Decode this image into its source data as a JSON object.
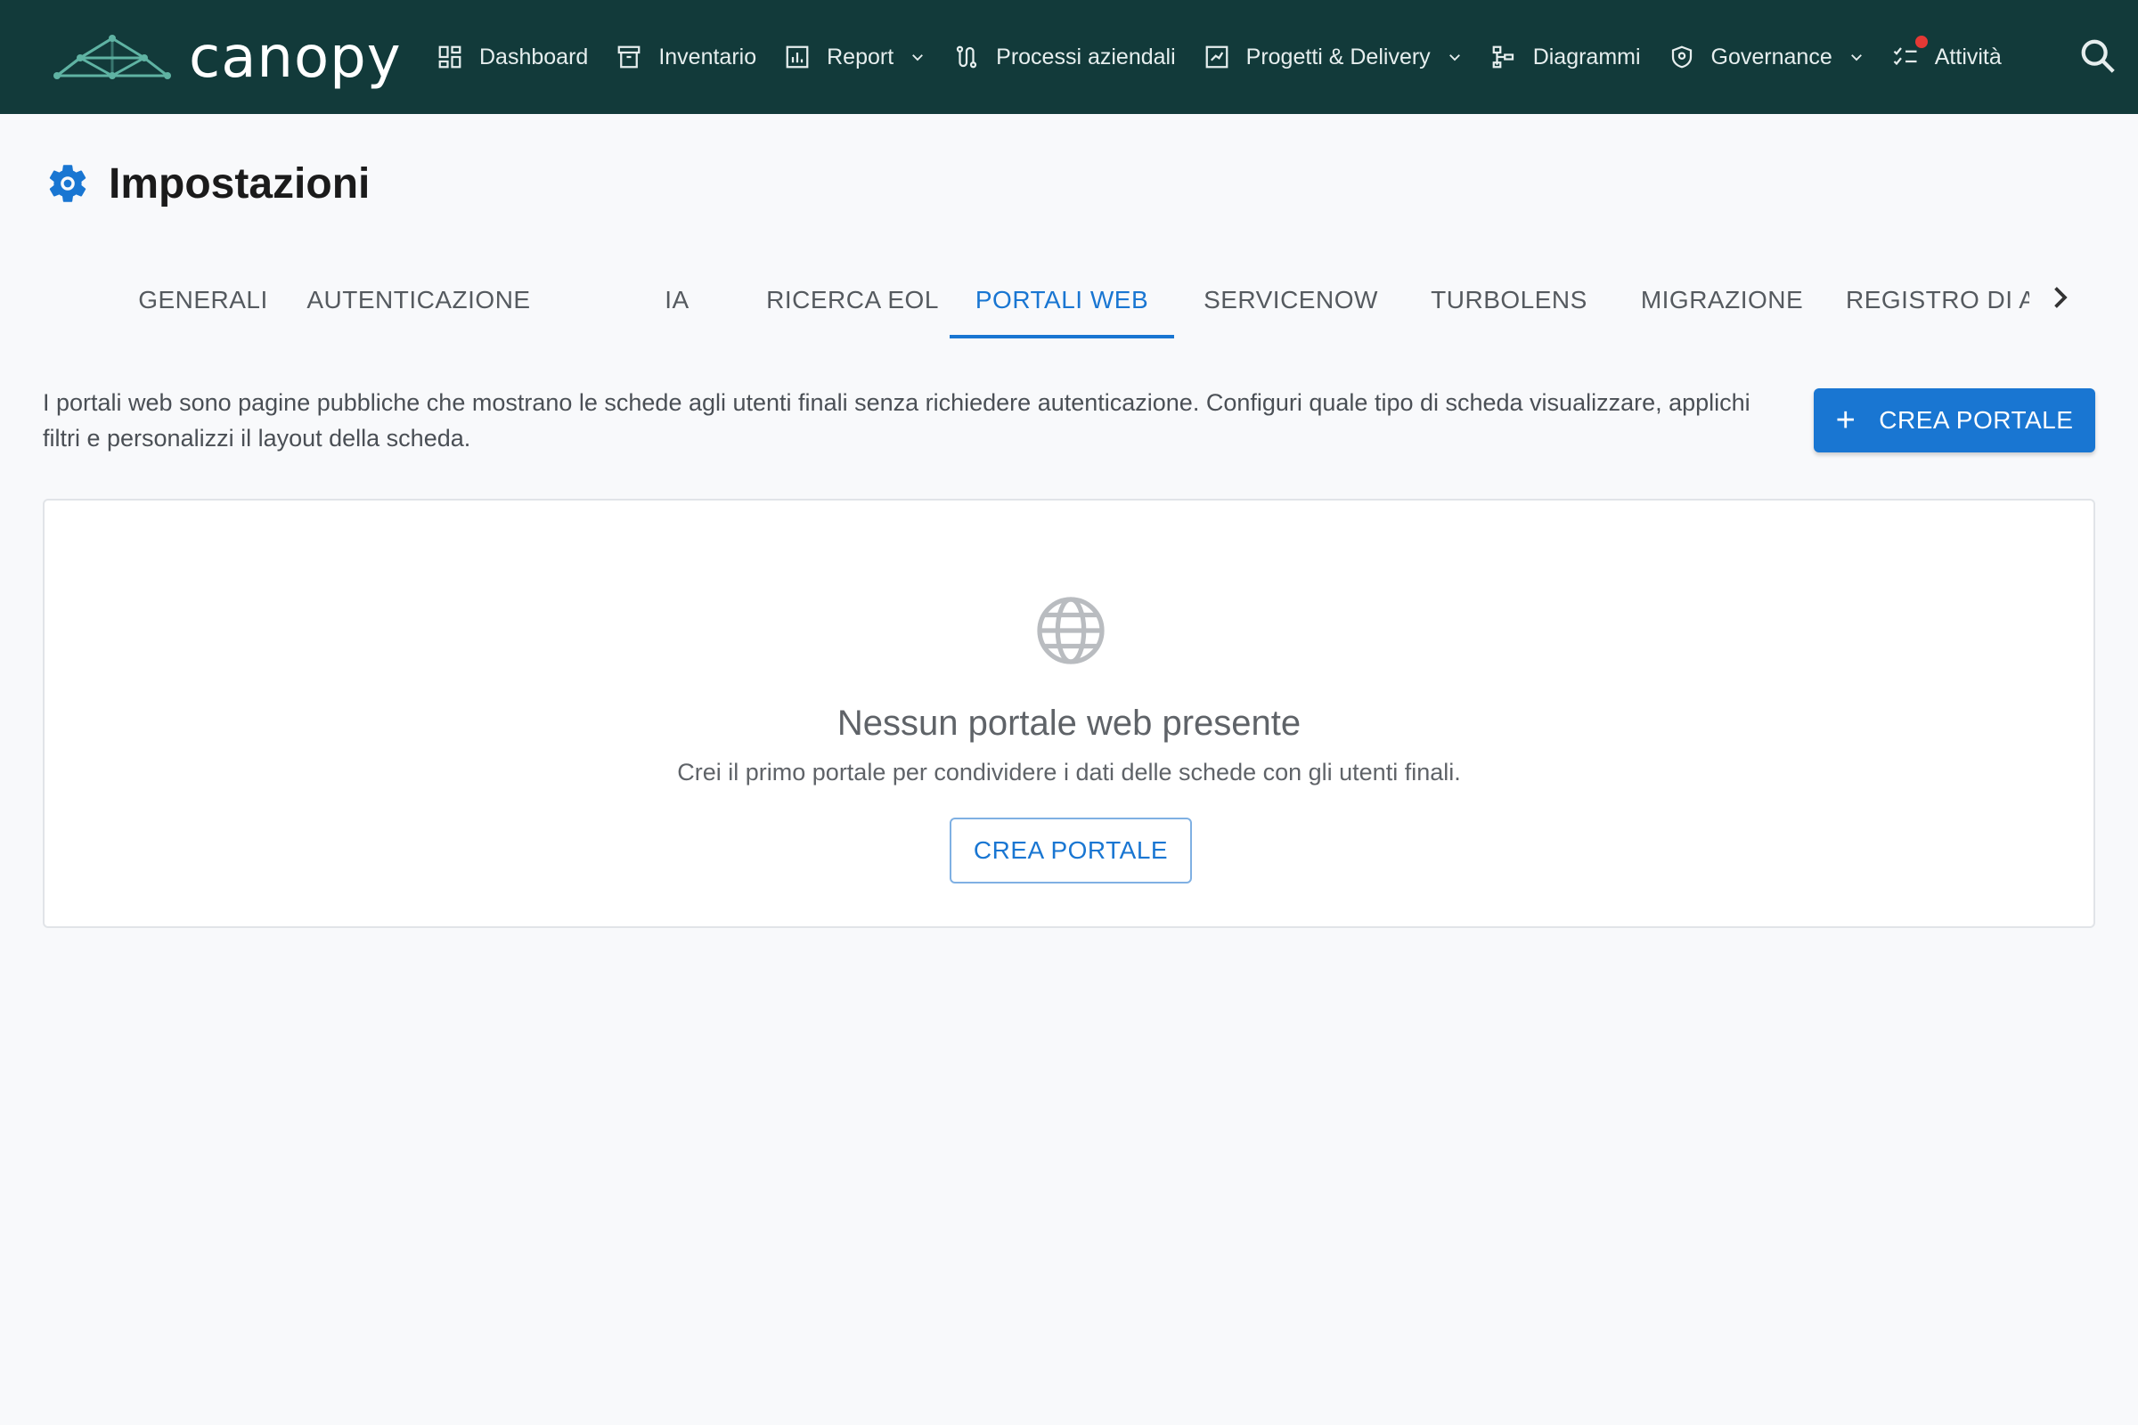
{
  "app": {
    "name": "canopy",
    "colors": {
      "topbar": "#123a3a",
      "accent": "#1976d2",
      "notification": "#e53935"
    }
  },
  "nav": {
    "items": [
      {
        "label": "Dashboard",
        "icon": "dashboard-icon",
        "has_dropdown": false
      },
      {
        "label": "Inventario",
        "icon": "archive-icon",
        "has_dropdown": false
      },
      {
        "label": "Report",
        "icon": "bar-chart-icon",
        "has_dropdown": true
      },
      {
        "label": "Processi aziendali",
        "icon": "route-icon",
        "has_dropdown": false
      },
      {
        "label": "Progetti & Delivery",
        "icon": "project-board-icon",
        "has_dropdown": true
      },
      {
        "label": "Diagrammi",
        "icon": "hierarchy-icon",
        "has_dropdown": false
      },
      {
        "label": "Governance",
        "icon": "shield-icon",
        "has_dropdown": true
      },
      {
        "label": "Attività",
        "icon": "checklist-icon",
        "has_dropdown": false,
        "has_notification": true
      }
    ],
    "search_icon": "search-icon"
  },
  "page": {
    "title": "Impostazioni",
    "title_icon": "gear-icon"
  },
  "tabs": {
    "items": [
      "GENERALI",
      "AUTENTICAZIONE",
      "IA",
      "RICERCA EOL",
      "PORTALI WEB",
      "SERVICENOW",
      "TURBOLENS",
      "MIGRAZIONE",
      "REGISTRO DI A"
    ],
    "active": "PORTALI WEB",
    "scroll_icon": "chevron-right-icon"
  },
  "content": {
    "description": "I portali web sono pagine pubbliche che mostrano le schede agli utenti finali senza richiedere autenticazione. Configuri quale tipo di scheda visualizzare, applichi filtri e personalizzi il layout della scheda.",
    "create_button": "CREA PORTALE",
    "empty_state": {
      "icon": "globe-icon",
      "title": "Nessun portale web presente",
      "subtitle": "Crei il primo portale per condividere i dati delle schede con gli utenti finali.",
      "button": "CREA PORTALE"
    }
  }
}
